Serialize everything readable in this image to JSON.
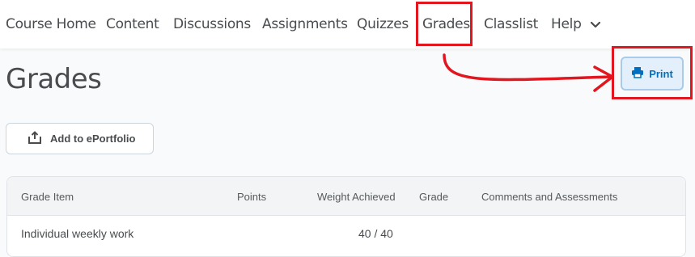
{
  "nav": {
    "items": [
      "Course Home",
      "Content",
      "Discussions",
      "Assignments",
      "Quizzes",
      "Grades",
      "Classlist"
    ],
    "help_label": "Help"
  },
  "page": {
    "title": "Grades",
    "print_label": "Print",
    "eportfolio_label": "Add to ePortfolio"
  },
  "table": {
    "headers": [
      "Grade Item",
      "Points",
      "Weight Achieved",
      "Grade",
      "Comments and Assessments"
    ],
    "rows": [
      {
        "item": "Individual weekly work",
        "points": "",
        "weight_achieved": "40 / 40",
        "grade": "",
        "comments": ""
      }
    ]
  },
  "colors": {
    "highlight": "#e1161e",
    "primary": "#006fbf"
  }
}
